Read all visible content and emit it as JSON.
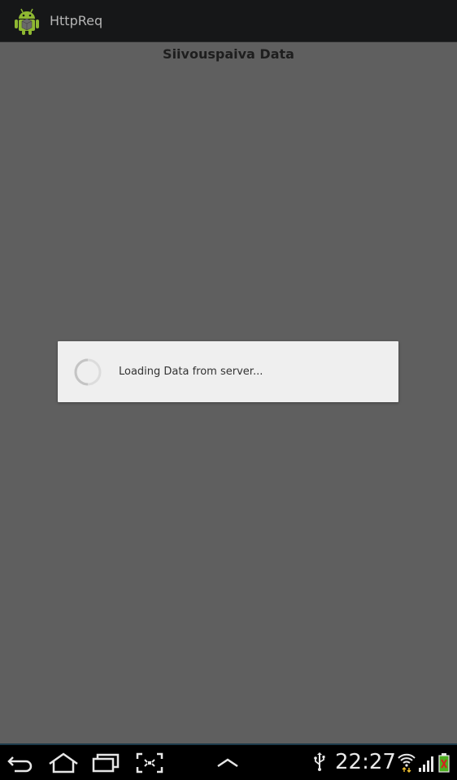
{
  "action_bar": {
    "app_title": "HttpReq",
    "app_icon": "android-robot-icon"
  },
  "content": {
    "header": "Siivouspaiva Data"
  },
  "dialog": {
    "message": "Loading Data from server...",
    "spinner_icon": "progress-spinner-icon"
  },
  "system_bar": {
    "clock": "22:27",
    "nav_icons": [
      "back-icon",
      "home-icon",
      "recent-apps-icon",
      "screenshot-icon",
      "menu-up-icon"
    ],
    "status_icons": [
      "usb-icon",
      "wifi-icon",
      "signal-icon",
      "battery-icon"
    ]
  },
  "colors": {
    "dim_background": "#5f5f5f",
    "dialog_background": "#efefef",
    "action_bar": "#161718",
    "android_green": "#8fb832",
    "battery_green": "#4caf1f"
  }
}
